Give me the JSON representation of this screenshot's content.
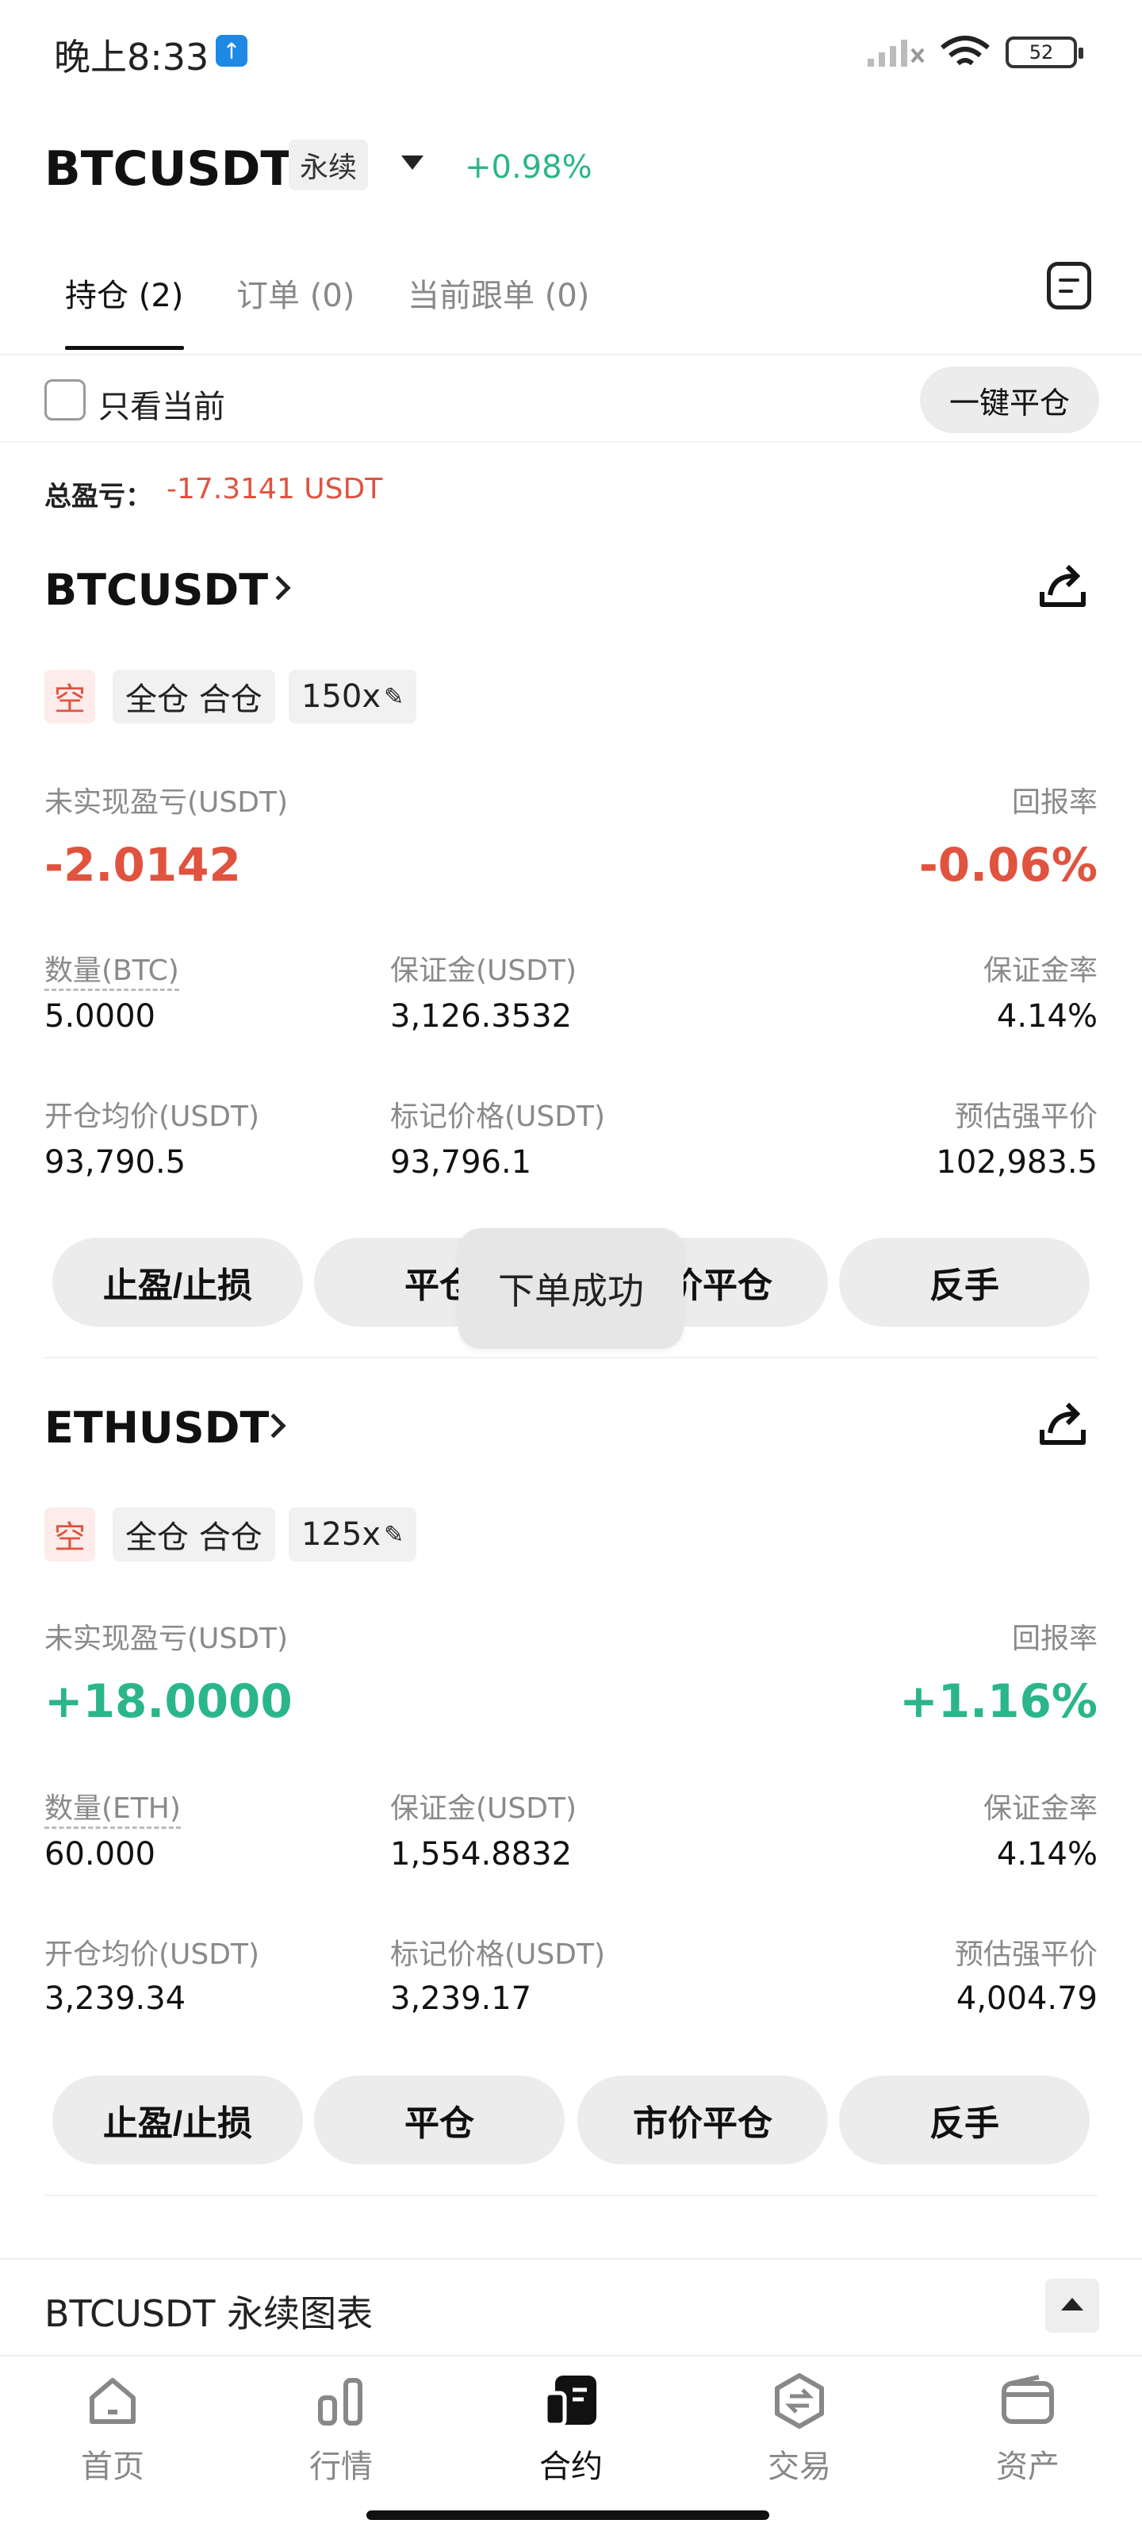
{
  "status_bar": {
    "time": "晚上8:33",
    "upload_icon": "arrow-up-icon",
    "battery": "52"
  },
  "header": {
    "symbol": "BTCUSDT",
    "contract_type": "永续",
    "change": "+0.98%"
  },
  "tabs": [
    {
      "label": "持仓 (2)"
    },
    {
      "label": "订单 (0)"
    },
    {
      "label": "当前跟单 (0)"
    }
  ],
  "filter": {
    "only_current": "只看当前",
    "close_all": "一键平仓"
  },
  "summary": {
    "total_pnl_label": "总盈亏：",
    "total_pnl_value": "-17.3141 USDT"
  },
  "positions": [
    {
      "symbol": "BTCUSDT",
      "side": "空",
      "margin_mode": "全仓 合仓",
      "leverage": "150x",
      "unrealized_label": "未实现盈亏(USDT)",
      "unrealized_value": "-2.0142",
      "roe_label": "回报率",
      "roe_value": "-0.06%",
      "qty_label": "数量(BTC)",
      "qty_value": "5.0000",
      "margin_label": "保证金(USDT)",
      "margin_value": "3,126.3532",
      "margin_ratio_label": "保证金率",
      "margin_ratio_value": "4.14%",
      "entry_label": "开仓均价(USDT)",
      "entry_value": "93,790.5",
      "mark_label": "标记价格(USDT)",
      "mark_value": "93,796.1",
      "liq_label": "预估强平价",
      "liq_value": "102,983.5",
      "actions": [
        "止盈/止损",
        "平仓",
        "市价平仓",
        "反手"
      ]
    },
    {
      "symbol": "ETHUSDT",
      "side": "空",
      "margin_mode": "全仓 合仓",
      "leverage": "125x",
      "unrealized_label": "未实现盈亏(USDT)",
      "unrealized_value": "+18.0000",
      "roe_label": "回报率",
      "roe_value": "+1.16%",
      "qty_label": "数量(ETH)",
      "qty_value": "60.000",
      "margin_label": "保证金(USDT)",
      "margin_value": "1,554.8832",
      "margin_ratio_label": "保证金率",
      "margin_ratio_value": "4.14%",
      "entry_label": "开仓均价(USDT)",
      "entry_value": "3,239.34",
      "mark_label": "标记价格(USDT)",
      "mark_value": "3,239.17",
      "liq_label": "预估强平价",
      "liq_value": "4,004.79",
      "actions": [
        "止盈/止损",
        "平仓",
        "市价平仓",
        "反手"
      ]
    }
  ],
  "toast": "下单成功",
  "chart_section": {
    "title": "BTCUSDT 永续图表"
  },
  "bottom_nav": [
    {
      "label": "首页",
      "icon": "home-icon"
    },
    {
      "label": "行情",
      "icon": "market-icon"
    },
    {
      "label": "合约",
      "icon": "futures-icon"
    },
    {
      "label": "交易",
      "icon": "trade-icon"
    },
    {
      "label": "资产",
      "icon": "wallet-icon"
    }
  ],
  "colors": {
    "up": "#2bb58a",
    "down": "#e0533f",
    "button_bg": "#ececec"
  }
}
